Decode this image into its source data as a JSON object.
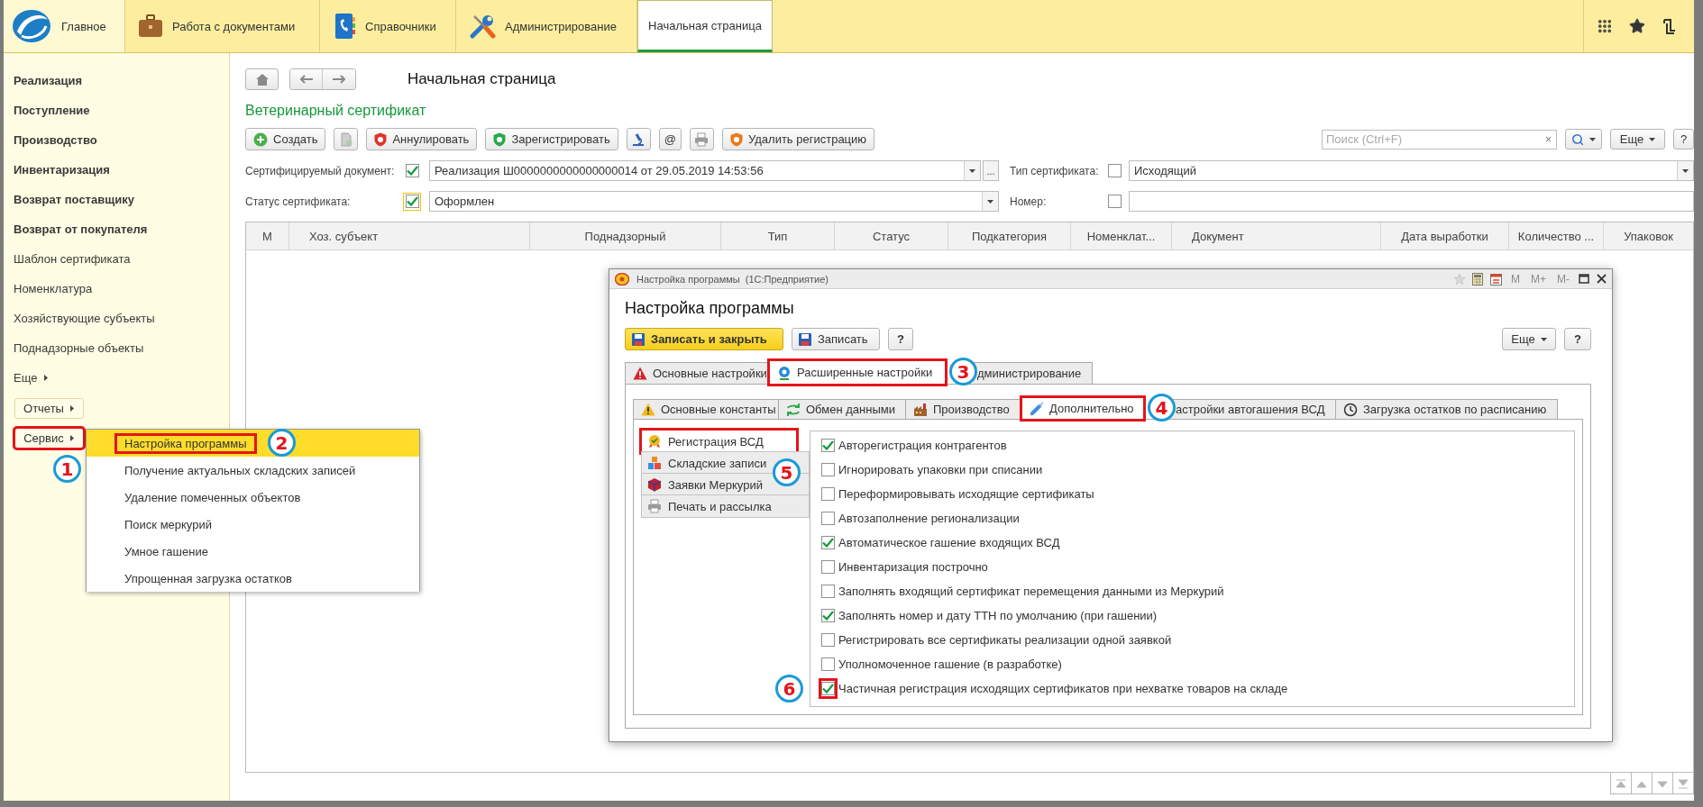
{
  "top_nav": {
    "sections": [
      {
        "label": "Главное"
      },
      {
        "label": "Работа с документами"
      },
      {
        "label": "Справочники"
      },
      {
        "label": "Администрирование"
      }
    ],
    "open_tabs": [
      {
        "label": "Начальная страница",
        "selected": true
      }
    ]
  },
  "sidebar": {
    "items": [
      {
        "label": "Реализация",
        "bold": true
      },
      {
        "label": "Поступление",
        "bold": true
      },
      {
        "label": "Производство",
        "bold": true
      },
      {
        "label": "Инвентаризация",
        "bold": true
      },
      {
        "label": "Возврат поставщику",
        "bold": true
      },
      {
        "label": "Возврат от покупателя",
        "bold": true
      },
      {
        "label": "Шаблон сертификата",
        "bold": false
      },
      {
        "label": "Номенклатура",
        "bold": false
      },
      {
        "label": "Хозяйствующие субъекты",
        "bold": false
      },
      {
        "label": "Поднадзорные объекты",
        "bold": false
      }
    ],
    "more": "Еще",
    "buttons": [
      {
        "label": "Отчеты",
        "highlighted": false
      },
      {
        "label": "Сервис",
        "highlighted": true,
        "callout": "1"
      }
    ]
  },
  "service_menu": {
    "items": [
      {
        "label": "Настройка программы",
        "selected": true,
        "highlighted": true,
        "callout": "2"
      },
      {
        "label": "Получение актуальных складских записей",
        "selected": false,
        "highlighted": false
      },
      {
        "label": "Удаление помеченных объектов",
        "selected": false,
        "highlighted": false
      },
      {
        "label": "Поиск меркурий",
        "selected": false,
        "highlighted": false
      },
      {
        "label": "Умное гашение",
        "selected": false,
        "highlighted": false
      },
      {
        "label": "Упрощенная загрузка остатков",
        "selected": false,
        "highlighted": false
      }
    ]
  },
  "page": {
    "title": "Начальная страница",
    "form_title": "Ветеринарный сертификат",
    "toolbar": [
      {
        "kind": "button",
        "label": "Создать"
      },
      {
        "kind": "icon"
      },
      {
        "kind": "button",
        "label": "Аннулировать"
      },
      {
        "kind": "button",
        "label": "Зарегистрировать"
      },
      {
        "kind": "icon"
      },
      {
        "kind": "button",
        "label": "@"
      },
      {
        "kind": "icon"
      },
      {
        "kind": "button",
        "label": "Удалить регистрацию"
      }
    ],
    "search": {
      "placeholder": "Поиск (Ctrl+F)",
      "clear": "×"
    },
    "more": "Еще",
    "help": "?",
    "filters": [
      [
        {
          "label": "Сертифицируемый документ:",
          "checked": true,
          "focused": false,
          "value": "Реализация Ш0000000000000000014 от 29.05.2019 14:53:56",
          "dropdown": true,
          "choose": "..."
        },
        {
          "label": "Тип сертификата:",
          "checked": false,
          "focused": false,
          "value": "Исходящий",
          "dropdown": true
        }
      ],
      [
        {
          "label": "Статус сертификата:",
          "checked": true,
          "focused": true,
          "value": "Оформлен",
          "dropdown": true
        },
        {
          "label": "Номер:",
          "checked": false,
          "focused": false,
          "dropdown": false
        }
      ]
    ],
    "table": {
      "columns": [
        "М",
        "Хоз. субъект",
        "Поднадзорный",
        "Тип",
        "Статус",
        "Подкатегория",
        "Номенклат...",
        "Документ",
        "Дата выработки",
        "Количество ...",
        "Упаковок"
      ]
    }
  },
  "dialog": {
    "window_title": "Настройка программы  (1С:Предприятие)",
    "window_buttons": [
      {
        "label": "M",
        "disabled": true
      },
      {
        "label": "M+",
        "disabled": true
      },
      {
        "label": "M-",
        "disabled": true
      }
    ],
    "title": "Настройка программы",
    "buttons": [
      {
        "label": "Записать и закрыть",
        "kind": "primary"
      },
      {
        "label": "Записать",
        "kind": "save"
      },
      {
        "label": "?",
        "kind": "plain"
      }
    ],
    "more": "Еще",
    "help": "?",
    "tabs": [
      {
        "label": "Основные настройки",
        "selected": false,
        "highlighted": false
      },
      {
        "label": "Расширенные настройки",
        "selected": true,
        "highlighted": true,
        "callout": "3"
      },
      {
        "label": "дминистрирование",
        "selected": false,
        "highlighted": false
      }
    ],
    "subtabs": [
      {
        "label": "Основные константы",
        "selected": false,
        "highlighted": false
      },
      {
        "label": "Обмен данными",
        "selected": false,
        "highlighted": false
      },
      {
        "label": "Производство",
        "selected": false,
        "highlighted": false
      },
      {
        "label": "Дополнительно",
        "selected": true,
        "highlighted": true,
        "callout": "4"
      },
      {
        "label": "астройки автогашения ВСД",
        "selected": false,
        "highlighted": false
      },
      {
        "label": "Загрузка остатков по расписанию",
        "selected": false,
        "highlighted": false
      }
    ],
    "sections": [
      {
        "label": "Регистрация ВСД",
        "selected": true,
        "highlighted": true,
        "callout": "5"
      },
      {
        "label": "Складские записи",
        "selected": false,
        "highlighted": false
      },
      {
        "label": "Заявки Меркурий",
        "selected": false,
        "highlighted": false
      },
      {
        "label": "Печать и рассылка",
        "selected": false,
        "highlighted": false
      }
    ],
    "options": [
      {
        "label": "Авторегистрация контрагентов",
        "checked": true,
        "highlighted": false
      },
      {
        "label": "Игнорировать упаковки при списании",
        "checked": false,
        "highlighted": false
      },
      {
        "label": "Переформировывать исходящие сертификаты",
        "checked": false,
        "highlighted": false
      },
      {
        "label": "Автозаполнение регионализации",
        "checked": false,
        "highlighted": false
      },
      {
        "label": "Автоматическое гашение входящих ВСД",
        "checked": true,
        "highlighted": false
      },
      {
        "label": "Инвентаризация построчно",
        "checked": false,
        "highlighted": false
      },
      {
        "label": "Заполнять входящий сертификат перемещения данными из Меркурий",
        "checked": false,
        "highlighted": false
      },
      {
        "label": "Заполнять номер и дату ТТН по умолчанию (при гашении)",
        "checked": true,
        "highlighted": false
      },
      {
        "label": "Регистрировать все сертификаты реализации одной заявкой",
        "checked": false,
        "highlighted": false
      },
      {
        "label": "Уполномоченное гашение (в разработке)",
        "checked": false,
        "highlighted": false
      },
      {
        "label": "Частичная регистрация исходящих сертификатов при нехватке товаров на складе",
        "checked": true,
        "highlighted": true,
        "callout": "6"
      }
    ]
  }
}
